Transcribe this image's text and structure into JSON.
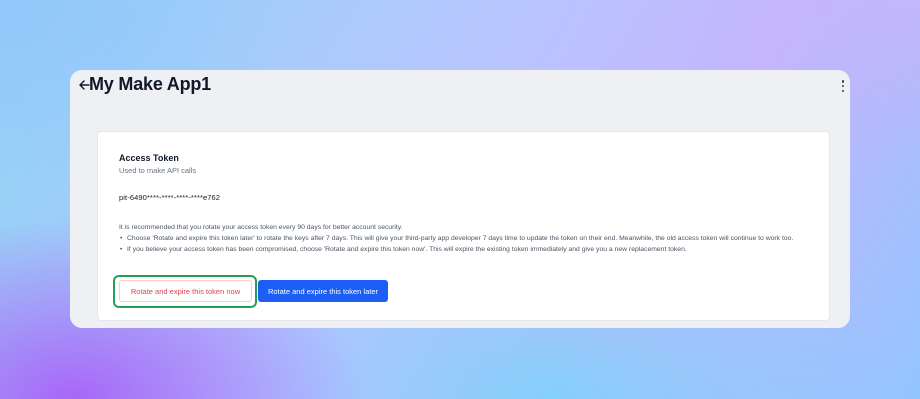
{
  "header": {
    "title": "My Make App1",
    "back_icon": "arrow-left-icon",
    "menu_icon": "more-vertical-icon"
  },
  "access_token": {
    "title": "Access Token",
    "subtitle": "Used to make API calls",
    "value": "pit-6490****-****-****-****e762",
    "recommendation": "It is recommended that you rotate your access token every 90 days for better account security.",
    "bullets": [
      "Choose 'Rotate and expire this token later' to rotate the keys after 7 days. This will give your third-party app developer 7 days time to update the token on their end. Meanwhile, the old access token will continue to work too.",
      "If you believe your access token has been compromised, choose 'Rotate and expire this token now'. This will expire the existing token immediately and give you a new replacement token."
    ]
  },
  "actions": {
    "rotate_now_label": "Rotate and expire this token now",
    "rotate_later_label": "Rotate and expire this token later"
  },
  "colors": {
    "primary": "#1d5ff5",
    "danger_text": "#e0424d",
    "highlight": "#22a05a"
  }
}
